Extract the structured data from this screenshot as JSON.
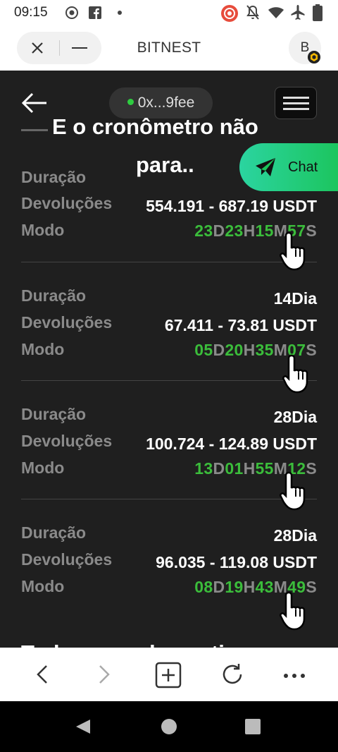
{
  "status_bar": {
    "time": "09:15",
    "icons": [
      "screen-record-icon",
      "facebook-icon",
      "dot-icon",
      "cast-icon",
      "notifications-off-icon",
      "wifi-icon",
      "airplane-icon",
      "battery-icon"
    ]
  },
  "browser": {
    "site_title": "BITNEST",
    "avatar_letter": "B"
  },
  "page": {
    "wallet": "0x...9fee",
    "overlay_line1": "E o cronômetro não",
    "overlay_line2": "para..",
    "chat_label": "Chat",
    "next_section_title": "Todas as ordens ativas"
  },
  "orders": [
    {
      "duration_label": "Duração",
      "duration_value": "",
      "returns_label": "Devoluções",
      "returns_value": "554.191 - 687.19 USDT",
      "mode_label": "Modo",
      "timer": {
        "d": "23",
        "h": "23",
        "m": "15",
        "s": "57"
      }
    },
    {
      "duration_label": "Duração",
      "duration_value": "14Dia",
      "returns_label": "Devoluções",
      "returns_value": "67.411 - 73.81 USDT",
      "mode_label": "Modo",
      "timer": {
        "d": "05",
        "h": "20",
        "m": "35",
        "s": "07"
      }
    },
    {
      "duration_label": "Duração",
      "duration_value": "28Dia",
      "returns_label": "Devoluções",
      "returns_value": "100.724 - 124.89 USDT",
      "mode_label": "Modo",
      "timer": {
        "d": "13",
        "h": "01",
        "m": "55",
        "s": "12"
      }
    },
    {
      "duration_label": "Duração",
      "duration_value": "28Dia",
      "returns_label": "Devoluções",
      "returns_value": "96.035 - 119.08 USDT",
      "mode_label": "Modo",
      "timer": {
        "d": "08",
        "h": "19",
        "m": "43",
        "s": "49"
      }
    }
  ],
  "timer_units": {
    "d": "D",
    "h": "H",
    "m": "M",
    "s": "S"
  },
  "colors": {
    "timer_green": "#3bbd3b",
    "chat_gradient_start": "#2bd4a0",
    "chat_gradient_end": "#1bc45a",
    "page_bg": "#1f1f1f"
  }
}
